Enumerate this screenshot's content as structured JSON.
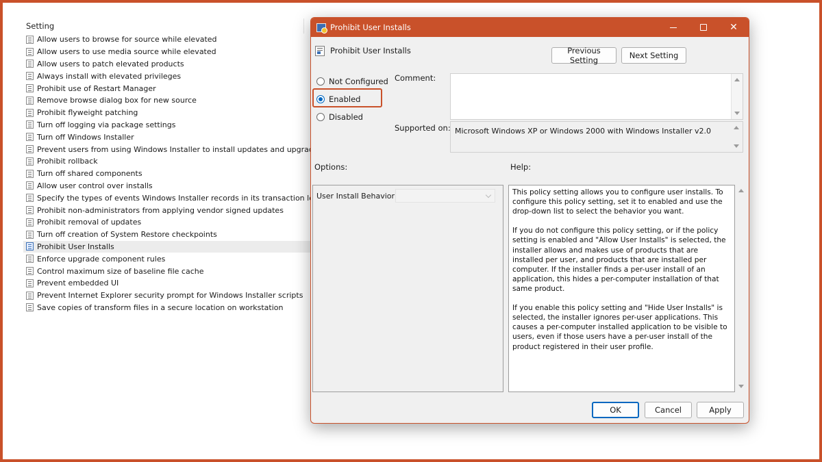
{
  "list": {
    "header": "Setting",
    "items": [
      "Allow users to browse for source while elevated",
      "Allow users to use media source while elevated",
      "Allow users to patch elevated products",
      "Always install with elevated privileges",
      "Prohibit use of Restart Manager",
      "Remove browse dialog box for new source",
      "Prohibit flyweight patching",
      "Turn off logging via package settings",
      "Turn off Windows Installer",
      "Prevent users from using Windows Installer to install updates and upgrades",
      "Prohibit rollback",
      "Turn off shared components",
      "Allow user control over installs",
      "Specify the types of events Windows Installer records in its transaction log",
      "Prohibit non-administrators from applying vendor signed updates",
      "Prohibit removal of updates",
      "Turn off creation of System Restore checkpoints",
      "Prohibit User Installs",
      "Enforce upgrade component rules",
      "Control maximum size of baseline file cache",
      "Prevent embedded UI",
      "Prevent Internet Explorer security prompt for Windows Installer scripts",
      "Save copies of transform files in a secure location on workstation"
    ],
    "selected_index": 17
  },
  "dialog": {
    "window_title": "Prohibit User Installs",
    "header_title": "Prohibit User Installs",
    "previous_setting": "Previous Setting",
    "next_setting": "Next Setting",
    "radios": {
      "not_configured": "Not Configured",
      "enabled": "Enabled",
      "disabled": "Disabled",
      "selected": "enabled"
    },
    "comment_label": "Comment:",
    "comment_value": "",
    "supported_on_label": "Supported on:",
    "supported_on_value": "Microsoft Windows XP or Windows 2000 with Windows Installer v2.0",
    "options_label": "Options:",
    "help_label": "Help:",
    "user_install_behavior_label": "User Install Behavior:",
    "user_install_behavior_value": "",
    "help_paragraphs": [
      "This policy setting allows you to configure user installs. To configure this policy setting, set it to enabled and use the drop-down list to select the behavior you want.",
      "If you do not configure this policy setting, or if the policy setting is enabled and \"Allow User Installs\" is selected, the installer allows and makes use of products that are installed per user, and products that are installed per computer. If the installer finds a per-user install of an application, this hides a per-computer installation of that same product.",
      "If you enable this policy setting and \"Hide User Installs\" is selected, the installer ignores per-user applications. This causes a per-computer installed application to be visible to users, even if those users have a per-user install of the product registered in their user profile."
    ],
    "ok": "OK",
    "cancel": "Cancel",
    "apply": "Apply"
  },
  "colors": {
    "accent": "#c9512a",
    "selection": "#0067c0"
  },
  "icons": {
    "window": "group-policy-icon",
    "list_item": "policy-setting-icon",
    "minimize": "minimize-icon",
    "maximize": "maximize-icon",
    "close": "close-icon"
  }
}
